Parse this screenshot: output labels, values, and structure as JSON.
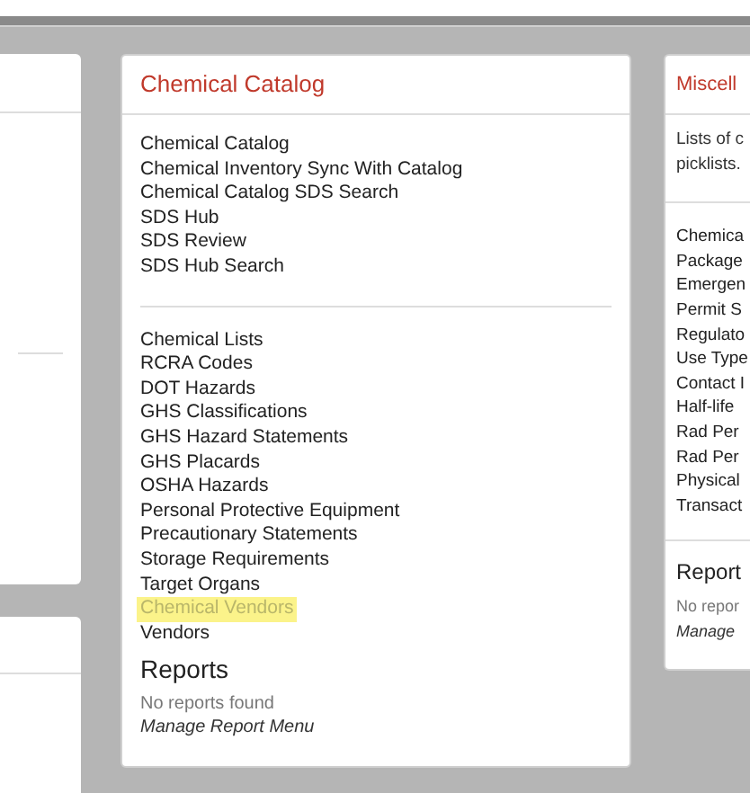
{
  "catalog_panel": {
    "title": "Chemical Catalog",
    "groups": [
      [
        {
          "label": "Chemical Catalog",
          "highlighted": false
        },
        {
          "label": "Chemical Inventory Sync With Catalog",
          "highlighted": false
        },
        {
          "label": "Chemical Catalog SDS Search",
          "highlighted": false
        },
        {
          "label": "SDS Hub",
          "highlighted": false
        },
        {
          "label": "SDS Review",
          "highlighted": false
        },
        {
          "label": "SDS Hub Search",
          "highlighted": false
        }
      ],
      [
        {
          "label": "Chemical Lists",
          "highlighted": false
        },
        {
          "label": "RCRA Codes",
          "highlighted": false
        },
        {
          "label": "DOT Hazards",
          "highlighted": false
        },
        {
          "label": "GHS Classifications",
          "highlighted": false
        },
        {
          "label": "GHS Hazard Statements",
          "highlighted": false
        },
        {
          "label": "GHS Placards",
          "highlighted": false
        },
        {
          "label": "OSHA Hazards",
          "highlighted": false
        },
        {
          "label": "Personal Protective Equipment",
          "highlighted": false
        },
        {
          "label": "Precautionary Statements",
          "highlighted": false
        },
        {
          "label": "Storage Requirements",
          "highlighted": false
        },
        {
          "label": "Target Organs",
          "highlighted": false
        },
        {
          "label": "Chemical Vendors",
          "highlighted": true
        },
        {
          "label": "Vendors",
          "highlighted": false
        }
      ]
    ],
    "reports": {
      "heading": "Reports",
      "empty_text": "No reports found",
      "manage_link": "Manage Report Menu"
    }
  },
  "misc_panel": {
    "title": "Miscell",
    "description": [
      "Lists of c",
      "picklists."
    ],
    "items": [
      "Chemica",
      "Package",
      "Emergen",
      "Permit S",
      "Regulato",
      "Use Type",
      "Contact I",
      "Half-life",
      "Rad Per",
      "Rad Per",
      "Physical",
      "Transact"
    ],
    "reports": {
      "heading": "Report",
      "empty_text": "No repor",
      "manage_link": "Manage"
    }
  }
}
